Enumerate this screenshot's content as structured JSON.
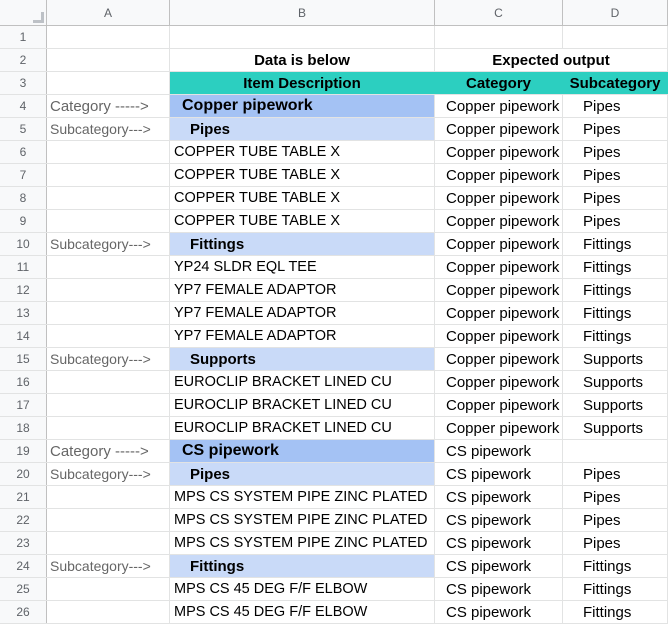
{
  "columns": [
    "A",
    "B",
    "C",
    "D"
  ],
  "header_row2": {
    "b": "Data is below",
    "cd": "Expected output"
  },
  "header_row3": {
    "b": "Item Description",
    "c": "Category",
    "d": "Subcategory"
  },
  "rows": [
    {
      "n": "4",
      "a": "Category ----->",
      "b": "Copper pipework",
      "c": "Copper pipework",
      "d": "Pipes",
      "kind": "cat"
    },
    {
      "n": "5",
      "a": "Subcategory--->",
      "b": "Pipes",
      "c": "Copper pipework",
      "d": "Pipes",
      "kind": "sub"
    },
    {
      "n": "6",
      "a": "",
      "b": "COPPER TUBE TABLE X",
      "c": "Copper pipework",
      "d": "Pipes",
      "kind": "item"
    },
    {
      "n": "7",
      "a": "",
      "b": "COPPER TUBE TABLE X",
      "c": "Copper pipework",
      "d": "Pipes",
      "kind": "item"
    },
    {
      "n": "8",
      "a": "",
      "b": "COPPER TUBE TABLE X",
      "c": "Copper pipework",
      "d": "Pipes",
      "kind": "item"
    },
    {
      "n": "9",
      "a": "",
      "b": "COPPER TUBE TABLE X",
      "c": "Copper pipework",
      "d": "Pipes",
      "kind": "item"
    },
    {
      "n": "10",
      "a": "Subcategory--->",
      "b": "Fittings",
      "c": "Copper pipework",
      "d": "Fittings",
      "kind": "sub"
    },
    {
      "n": "11",
      "a": "",
      "b": "YP24 SLDR EQL TEE",
      "c": "Copper pipework",
      "d": "Fittings",
      "kind": "item"
    },
    {
      "n": "12",
      "a": "",
      "b": "YP7 FEMALE ADAPTOR",
      "c": "Copper pipework",
      "d": "Fittings",
      "kind": "item"
    },
    {
      "n": "13",
      "a": "",
      "b": "YP7 FEMALE ADAPTOR",
      "c": "Copper pipework",
      "d": "Fittings",
      "kind": "item"
    },
    {
      "n": "14",
      "a": "",
      "b": "YP7 FEMALE ADAPTOR",
      "c": "Copper pipework",
      "d": "Fittings",
      "kind": "item"
    },
    {
      "n": "15",
      "a": "Subcategory--->",
      "b": "Supports",
      "c": "Copper pipework",
      "d": "Supports",
      "kind": "sub"
    },
    {
      "n": "16",
      "a": "",
      "b": "EUROCLIP BRACKET LINED   CU",
      "c": "Copper pipework",
      "d": "Supports",
      "kind": "item"
    },
    {
      "n": "17",
      "a": "",
      "b": "EUROCLIP BRACKET LINED   CU",
      "c": "Copper pipework",
      "d": "Supports",
      "kind": "item"
    },
    {
      "n": "18",
      "a": "",
      "b": "EUROCLIP BRACKET LINED   CU",
      "c": "Copper pipework",
      "d": "Supports",
      "kind": "item"
    },
    {
      "n": "19",
      "a": "Category ----->",
      "b": "CS pipework",
      "c": "CS pipework",
      "d": "",
      "kind": "cat"
    },
    {
      "n": "20",
      "a": "Subcategory--->",
      "b": "Pipes",
      "c": "CS pipework",
      "d": "Pipes",
      "kind": "sub"
    },
    {
      "n": "21",
      "a": "",
      "b": "MPS CS SYSTEM PIPE ZINC PLATED",
      "c": "CS pipework",
      "d": "Pipes",
      "kind": "item"
    },
    {
      "n": "22",
      "a": "",
      "b": "MPS CS SYSTEM PIPE ZINC PLATED",
      "c": "CS pipework",
      "d": "Pipes",
      "kind": "item"
    },
    {
      "n": "23",
      "a": "",
      "b": "MPS CS SYSTEM PIPE ZINC PLATED",
      "c": "CS pipework",
      "d": "Pipes",
      "kind": "item"
    },
    {
      "n": "24",
      "a": "Subcategory--->",
      "b": "Fittings",
      "c": "CS pipework",
      "d": "Fittings",
      "kind": "sub"
    },
    {
      "n": "25",
      "a": "",
      "b": "MPS CS 45 DEG F/F ELBOW",
      "c": "CS pipework",
      "d": "Fittings",
      "kind": "item"
    },
    {
      "n": "26",
      "a": "",
      "b": "MPS CS 45 DEG F/F ELBOW",
      "c": "CS pipework",
      "d": "Fittings",
      "kind": "item"
    }
  ],
  "colors": {
    "header_teal": "#2ccfc0",
    "category_fill": "#a4c2f4",
    "subcategory_fill": "#c9daf8"
  }
}
